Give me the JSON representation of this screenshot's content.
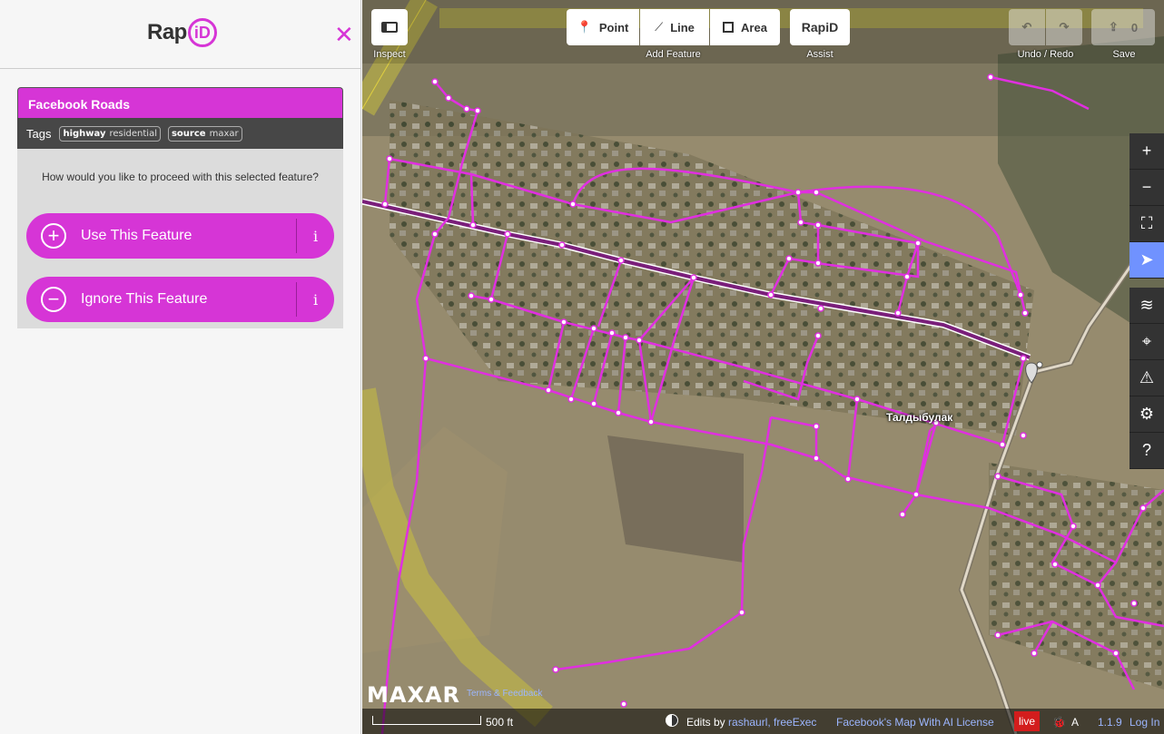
{
  "sidebar": {
    "logo_text": "Rap",
    "logo_id": "iD",
    "close_icon": "close-icon",
    "feature": {
      "title": "Facebook Roads",
      "tags_label": "Tags",
      "tags": [
        {
          "key": "highway",
          "value": "residential"
        },
        {
          "key": "source",
          "value": "maxar"
        }
      ],
      "question": "How would you like to proceed with this selected feature?",
      "use_label": "Use This Feature",
      "ignore_label": "Ignore This Feature",
      "info_label": "i"
    }
  },
  "toolbar": {
    "inspect_caption": "Inspect",
    "add_feature_caption": "Add Feature",
    "point_label": "Point",
    "line_label": "Line",
    "area_label": "Area",
    "assist_caption": "Assist",
    "assist_logo": "RapiD",
    "undo_redo_caption": "Undo / Redo",
    "save_caption": "Save",
    "save_count": "0"
  },
  "map": {
    "place_label": "Талдыбулак",
    "colors": {
      "road": "#e02fe0",
      "accent": "#d635d6",
      "boundary": "#c8c040",
      "track": "#e0d8c8"
    }
  },
  "footer": {
    "maxar_logo": "MAXAR",
    "maxar_link": "Terms & Feedback",
    "scale_label": "500 ft",
    "edits_by": "Edits by",
    "editors": "rashaurl, freeExec",
    "license": "Facebook's Map With AI License",
    "live": "live",
    "version": "1.1.9",
    "login": "Log In"
  }
}
